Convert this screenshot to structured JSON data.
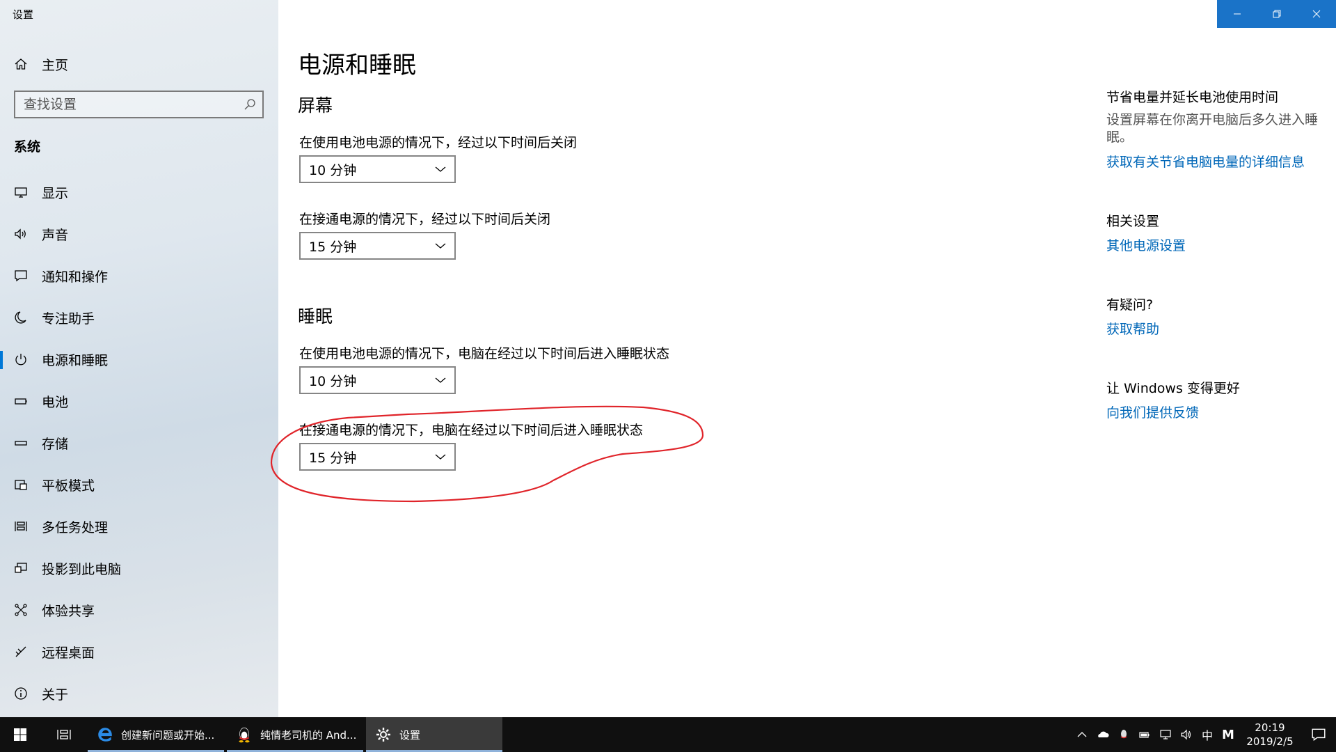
{
  "window": {
    "title": "设置"
  },
  "sidebar": {
    "home_label": "主页",
    "search_placeholder": "查找设置",
    "section": "系统",
    "items": [
      {
        "label": "显示",
        "icon": "monitor-icon"
      },
      {
        "label": "声音",
        "icon": "speaker-icon"
      },
      {
        "label": "通知和操作",
        "icon": "message-icon"
      },
      {
        "label": "专注助手",
        "icon": "moon-icon"
      },
      {
        "label": "电源和睡眠",
        "icon": "power-icon",
        "active": true
      },
      {
        "label": "电池",
        "icon": "battery-icon"
      },
      {
        "label": "存储",
        "icon": "storage-icon"
      },
      {
        "label": "平板模式",
        "icon": "tablet-icon"
      },
      {
        "label": "多任务处理",
        "icon": "multitask-icon"
      },
      {
        "label": "投影到此电脑",
        "icon": "project-icon"
      },
      {
        "label": "体验共享",
        "icon": "share-icon"
      },
      {
        "label": "远程桌面",
        "icon": "remote-icon"
      },
      {
        "label": "关于",
        "icon": "info-icon"
      }
    ]
  },
  "main": {
    "title": "电源和睡眠",
    "screen": {
      "heading": "屏幕",
      "battery_label": "在使用电池电源的情况下，经过以下时间后关闭",
      "battery_value": "10 分钟",
      "plugged_label": "在接通电源的情况下，经过以下时间后关闭",
      "plugged_value": "15 分钟"
    },
    "sleep": {
      "heading": "睡眠",
      "battery_label": "在使用电池电源的情况下，电脑在经过以下时间后进入睡眠状态",
      "battery_value": "10 分钟",
      "plugged_label": "在接通电源的情况下，电脑在经过以下时间后进入睡眠状态",
      "plugged_value": "15 分钟"
    },
    "annotation_color": "#e0242a"
  },
  "right": {
    "save_heading": "节省电量并延长电池使用时间",
    "save_text": "设置屏幕在你离开电脑后多久进入睡眠。",
    "save_link": "获取有关节省电脑电量的详细信息",
    "related_heading": "相关设置",
    "related_link": "其他电源设置",
    "question_heading": "有疑问?",
    "question_link": "获取帮助",
    "feedback_heading": "让 Windows 变得更好",
    "feedback_link": "向我们提供反馈"
  },
  "taskbar": {
    "apps": [
      {
        "label": "创建新问题或开始...",
        "icon": "edge-icon"
      },
      {
        "label": "纯情老司机的 And...",
        "icon": "qq-icon"
      },
      {
        "label": "设置",
        "icon": "gear-icon",
        "active": true
      }
    ],
    "ime": "中",
    "ime2": "M",
    "time": "20:19",
    "date": "2019/2/5"
  },
  "colors": {
    "accent": "#0078d7",
    "link": "#0067b8",
    "titlebar_buttons": "#1a73c8"
  }
}
